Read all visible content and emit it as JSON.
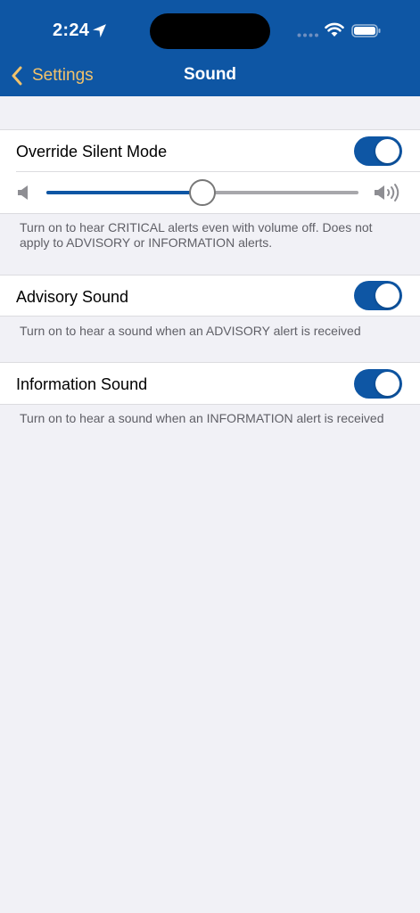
{
  "status_bar": {
    "time": "2:24"
  },
  "nav": {
    "back_label": "Settings",
    "title": "Sound"
  },
  "override": {
    "label": "Override Silent Mode",
    "on": true,
    "volume_fraction": 0.5,
    "footnote": "Turn on to hear CRITICAL alerts even with volume off. Does not apply to ADVISORY or INFORMATION alerts."
  },
  "advisory": {
    "label": "Advisory Sound",
    "on": true,
    "footnote": "Turn on to hear a sound when an ADVISORY alert is received"
  },
  "information": {
    "label": "Information Sound",
    "on": true,
    "footnote": "Turn on to hear a sound when an INFORMATION alert is received"
  },
  "colors": {
    "brand": "#0e56a4",
    "accent": "#f2c26b",
    "background": "#f1f1f6"
  },
  "icons": [
    "location-arrow-icon",
    "wifi-icon",
    "battery-icon",
    "chevron-left-icon",
    "speaker-low-icon",
    "speaker-high-icon"
  ]
}
